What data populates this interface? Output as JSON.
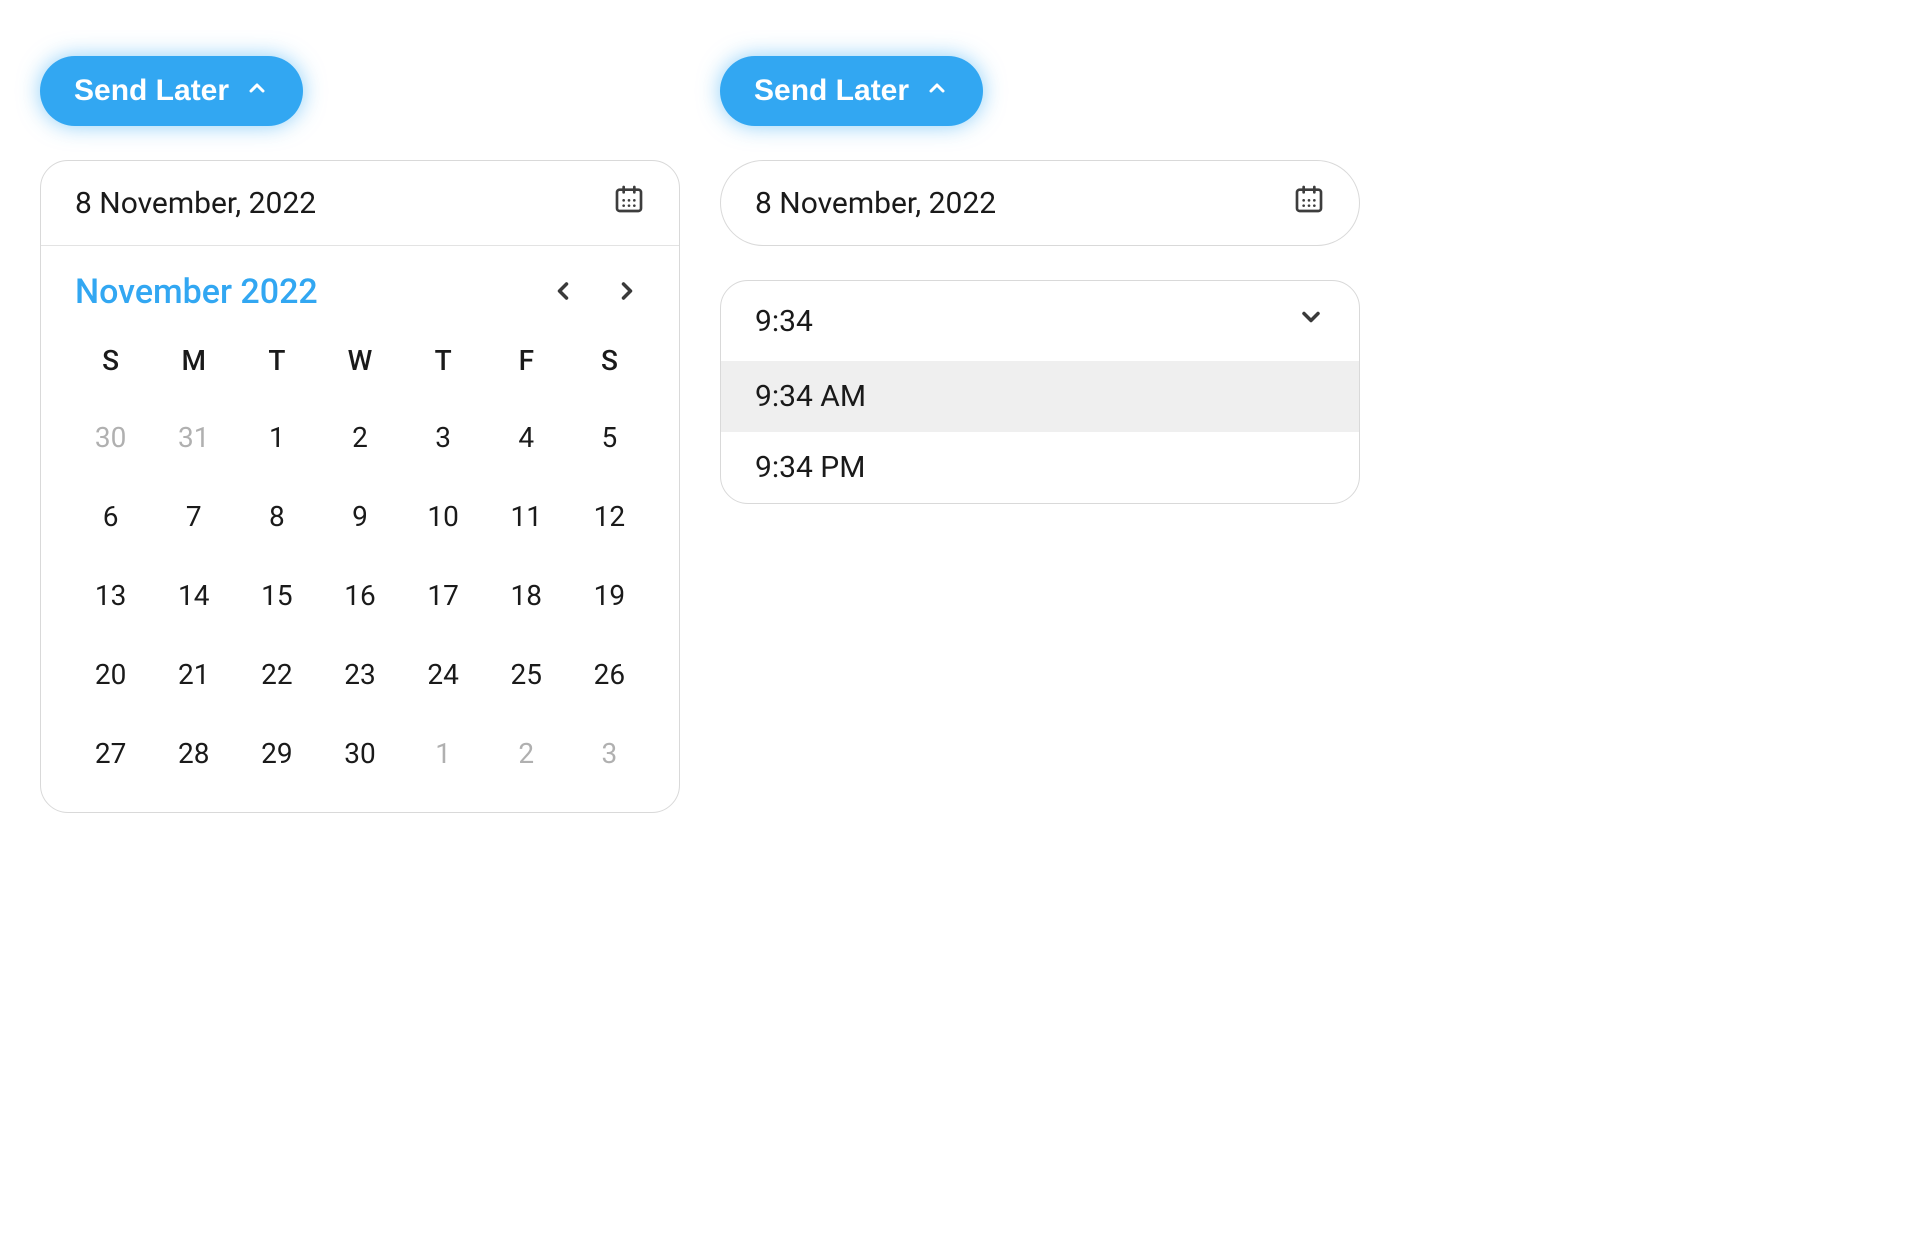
{
  "button_label": "Send Later",
  "date_display": "8 November, 2022",
  "calendar": {
    "month_label": "November 2022",
    "dow": [
      "S",
      "M",
      "T",
      "W",
      "T",
      "F",
      "S"
    ],
    "days": [
      {
        "n": "30",
        "other": true
      },
      {
        "n": "31",
        "other": true
      },
      {
        "n": "1"
      },
      {
        "n": "2"
      },
      {
        "n": "3"
      },
      {
        "n": "4"
      },
      {
        "n": "5"
      },
      {
        "n": "6"
      },
      {
        "n": "7"
      },
      {
        "n": "8"
      },
      {
        "n": "9"
      },
      {
        "n": "10"
      },
      {
        "n": "11"
      },
      {
        "n": "12"
      },
      {
        "n": "13"
      },
      {
        "n": "14"
      },
      {
        "n": "15"
      },
      {
        "n": "16"
      },
      {
        "n": "17"
      },
      {
        "n": "18"
      },
      {
        "n": "19"
      },
      {
        "n": "20"
      },
      {
        "n": "21"
      },
      {
        "n": "22"
      },
      {
        "n": "23"
      },
      {
        "n": "24"
      },
      {
        "n": "25"
      },
      {
        "n": "26"
      },
      {
        "n": "27"
      },
      {
        "n": "28"
      },
      {
        "n": "29"
      },
      {
        "n": "30"
      },
      {
        "n": "1",
        "other": true
      },
      {
        "n": "2",
        "other": true
      },
      {
        "n": "3",
        "other": true
      }
    ]
  },
  "time": {
    "current": "9:34",
    "options": [
      {
        "label": "9:34 AM",
        "selected": true
      },
      {
        "label": "9:34 PM",
        "selected": false
      }
    ]
  }
}
